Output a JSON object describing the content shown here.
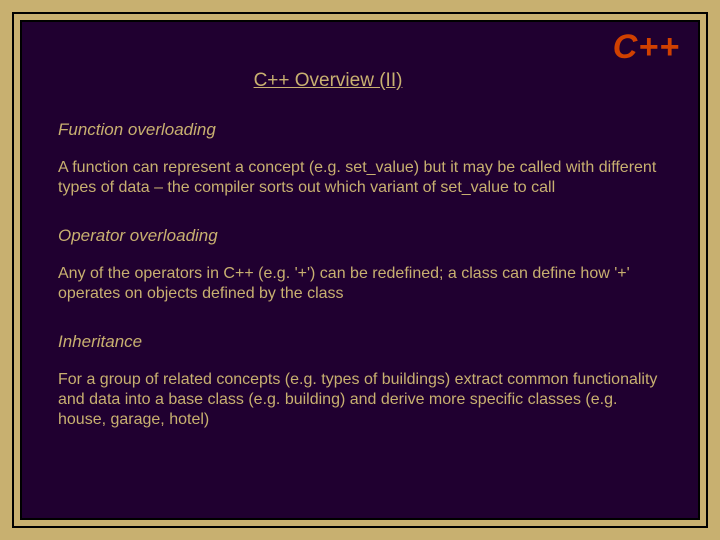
{
  "corner_label": "C++",
  "title": "C++ Overview (II)",
  "sections": [
    {
      "heading": "Function overloading",
      "body": "A function can represent a concept (e.g. set_value) but it may be called with different types of data – the compiler sorts out which variant of set_value to call"
    },
    {
      "heading": "Operator overloading",
      "body": "Any of the operators in C++ (e.g. '+') can be redefined; a class can define how '+' operates on objects defined by the class"
    },
    {
      "heading": "Inheritance",
      "body": "For a group of related concepts (e.g. types of buildings) extract common functionality and data into a base class (e.g. building) and derive more specific classes (e.g. house, garage, hotel)"
    }
  ]
}
